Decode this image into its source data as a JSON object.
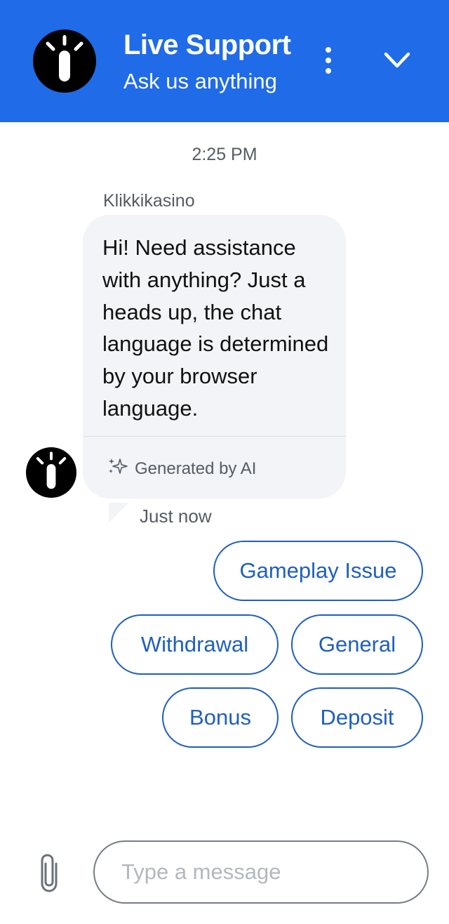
{
  "header": {
    "title": "Live Support",
    "subtitle": "Ask us anything",
    "background_color": "#1f6be8",
    "logo_icon": "lamp-logo-icon",
    "menu_icon": "more-vertical-icon",
    "collapse_icon": "chevron-down-icon"
  },
  "conversation": {
    "timestamp": "2:25 PM",
    "sender_name": "Klikkikasino",
    "message_text": "Hi! Need assistance with anything? Just a heads up, the chat language is determined by your browser language.",
    "ai_badge_label": "Generated by AI",
    "ai_badge_icon": "sparkle-icon",
    "message_time": "Just now",
    "avatar_icon": "lamp-logo-icon"
  },
  "quick_replies": [
    {
      "label": "Gameplay Issue"
    },
    {
      "label": "Withdrawal"
    },
    {
      "label": "General"
    },
    {
      "label": "Bonus"
    },
    {
      "label": "Deposit"
    }
  ],
  "composer": {
    "placeholder": "Type a message",
    "value": "",
    "attach_icon": "paperclip-icon"
  },
  "colors": {
    "accent": "#1f6be8",
    "quick_reply": "#1f5fbf",
    "bubble_background": "#f2f4f7"
  }
}
